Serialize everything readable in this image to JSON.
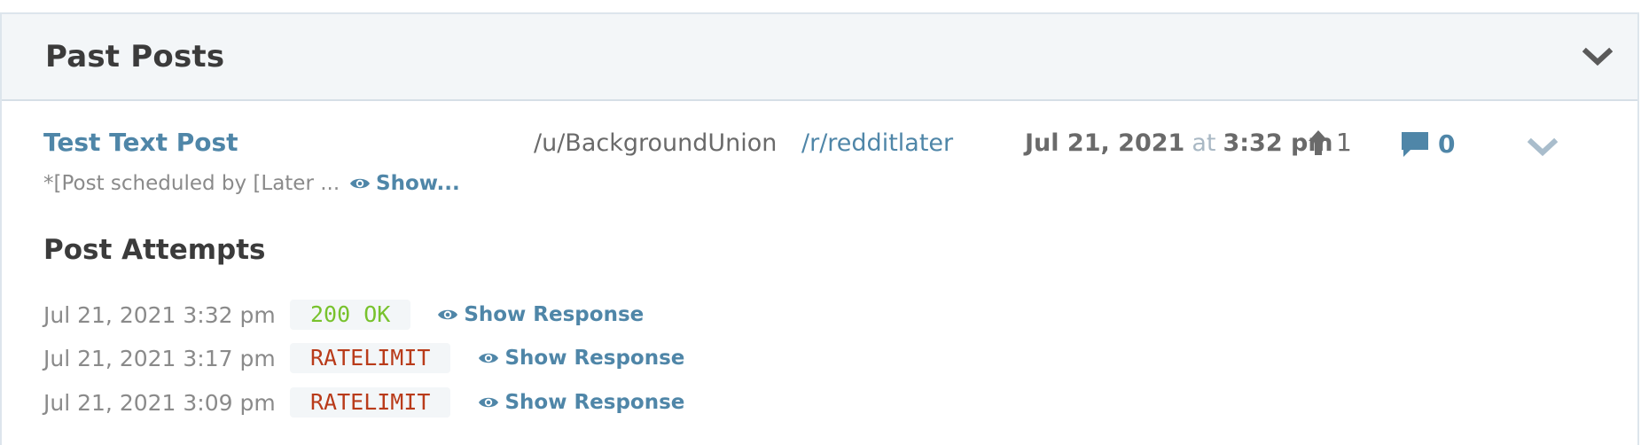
{
  "section": {
    "title": "Past Posts",
    "collapse_icon": "chevron-down-icon"
  },
  "post": {
    "title": "Test Text Post",
    "body_preview": "*[Post scheduled by [Later ...",
    "show_body_label": "Show...",
    "author": "/u/BackgroundUnion",
    "subreddit": "/r/redditlater",
    "date": "Jul 21, 2021",
    "at_word": "at",
    "time": "3:32 pm",
    "upvotes": "1",
    "comments": "0",
    "expand_icon": "chevron-down-icon"
  },
  "attempts": {
    "title": "Post Attempts",
    "rows": [
      {
        "datetime": "Jul 21, 2021 3:32 pm",
        "status": "200 OK",
        "status_type": "ok",
        "action_label": "Show Response"
      },
      {
        "datetime": "Jul 21, 2021 3:17 pm",
        "status": "RATELIMIT",
        "status_type": "error",
        "action_label": "Show Response"
      },
      {
        "datetime": "Jul 21, 2021 3:09 pm",
        "status": "RATELIMIT",
        "status_type": "error",
        "action_label": "Show Response"
      }
    ]
  },
  "colors": {
    "link": "#4f86a8",
    "ok": "#78c22d",
    "error": "#b93b1a",
    "header_bg": "#f3f6f8"
  }
}
